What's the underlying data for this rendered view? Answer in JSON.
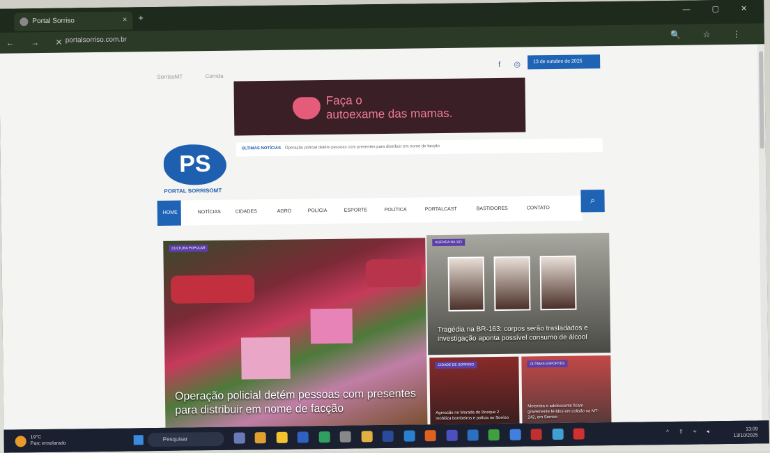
{
  "browser": {
    "tab_title": "Portal Sorriso",
    "url": "portalsorriso.com.br",
    "new_tab_symbol": "+",
    "tab_close_symbol": "×",
    "nav_buttons": "← → ✕",
    "right_icons": "🔍 ☆ ⋮",
    "window_controls": "— ▢ ✕"
  },
  "site": {
    "top_links": [
      "SorrisoMT",
      "Corrida"
    ],
    "social_icons": "f ◎",
    "date": "13 de outubro de 2025",
    "banner_text_line1": "Faça o",
    "banner_text_line2": "autoexame das mamas.",
    "logo_mark": "PS",
    "logo_name": "PORTAL SORRISOMT",
    "ticker_label": "ÚLTIMAS NOTÍCIAS",
    "ticker_text": "Operação policial detém pessoas com presentes para distribuir em nome de facção",
    "search_icon": "⌕",
    "menu": [
      "HOME",
      "NOTÍCIAS",
      "CIDADES",
      "AGRO",
      "POLÍCIA",
      "ESPORTE",
      "POLÍTICA",
      "PORTALCAST",
      "BASTIDORES",
      "CONTATO"
    ]
  },
  "articles": {
    "main": {
      "tag": "CULTURA POPULAR",
      "title": "Operação policial detém pessoas com presentes para distribuir em nome de facção"
    },
    "right_top": {
      "tag": "AGENDA NA 163",
      "title": "Tragédia na BR-163: corpos serão trasladados e investigação aponta possível consumo de álcool"
    },
    "right_bottom_left": {
      "tag": "CIDADE DE SORRISO",
      "title": "Agressão no Morada do Bosque 2 mobiliza bombeiros e polícia no Sorriso"
    },
    "right_bottom_right": {
      "tag": "ÚLTIMAS ESPORTES",
      "title": "Motorista e adolescente ficam gravemente feridos em colisão na MT-242, em Sorriso"
    }
  },
  "taskbar": {
    "weather_temp": "19°C",
    "weather_desc": "Parc ensolarado",
    "search_placeholder": "Pesquisar",
    "lang_line1": "POR",
    "lang_line2": "PTB2",
    "tray_icons": "^ ⇧ ≈ ◂",
    "time": "13:09",
    "date": "13/10/2025"
  },
  "colors": {
    "brand_blue": "#1f63b5",
    "tag_purple": "#5b3ea8",
    "banner_bg": "#3a1f26",
    "banner_text": "#f07a97"
  }
}
